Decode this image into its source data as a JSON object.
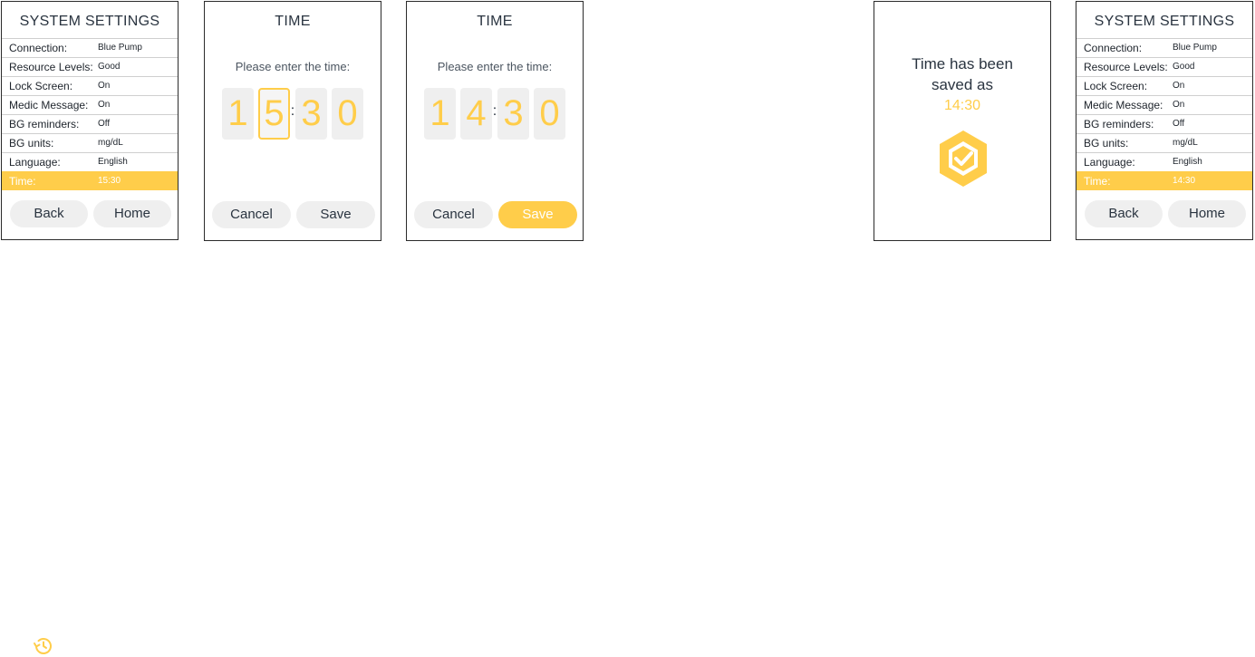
{
  "colors": {
    "accent": "#ffcd4a",
    "text": "#2a3440",
    "button_bg": "#efefef"
  },
  "settings_before": {
    "title": "SYSTEM SETTINGS",
    "rows": [
      {
        "label": "Connection:",
        "value": "Blue Pump"
      },
      {
        "label": "Resource Levels:",
        "value": "Good"
      },
      {
        "label": "Lock Screen:",
        "value": "On"
      },
      {
        "label": "Medic Message:",
        "value": "On"
      },
      {
        "label": "BG reminders:",
        "value": "Off"
      },
      {
        "label": "BG units:",
        "value": "mg/dL"
      },
      {
        "label": "Language:",
        "value": "English"
      },
      {
        "label": "Time:",
        "value": "15:30"
      }
    ],
    "back_label": "Back",
    "home_label": "Home"
  },
  "time_edit": {
    "title": "TIME",
    "prompt": "Please enter the time:",
    "digits": [
      "1",
      "5",
      "3",
      "0"
    ],
    "colon": ":",
    "cancel_label": "Cancel",
    "save_label": "Save"
  },
  "time_edit_changed": {
    "title": "TIME",
    "prompt": "Please enter the time:",
    "digits": [
      "1",
      "4",
      "3",
      "0"
    ],
    "colon": ":",
    "cancel_label": "Cancel",
    "save_label": "Save"
  },
  "confirmation": {
    "line1": "Time has been",
    "line2": "saved as",
    "time": "14:30",
    "icon": "hexagon-check-icon"
  },
  "settings_after": {
    "title": "SYSTEM SETTINGS",
    "rows": [
      {
        "label": "Connection:",
        "value": "Blue Pump"
      },
      {
        "label": "Resource Levels:",
        "value": "Good"
      },
      {
        "label": "Lock Screen:",
        "value": "On"
      },
      {
        "label": "Medic Message:",
        "value": "On"
      },
      {
        "label": "BG reminders:",
        "value": "Off"
      },
      {
        "label": "BG units:",
        "value": "mg/dL"
      },
      {
        "label": "Language:",
        "value": "English"
      },
      {
        "label": "Time:",
        "value": "14:30"
      }
    ],
    "back_label": "Back",
    "home_label": "Home"
  },
  "footer": {
    "icon": "history-icon"
  }
}
